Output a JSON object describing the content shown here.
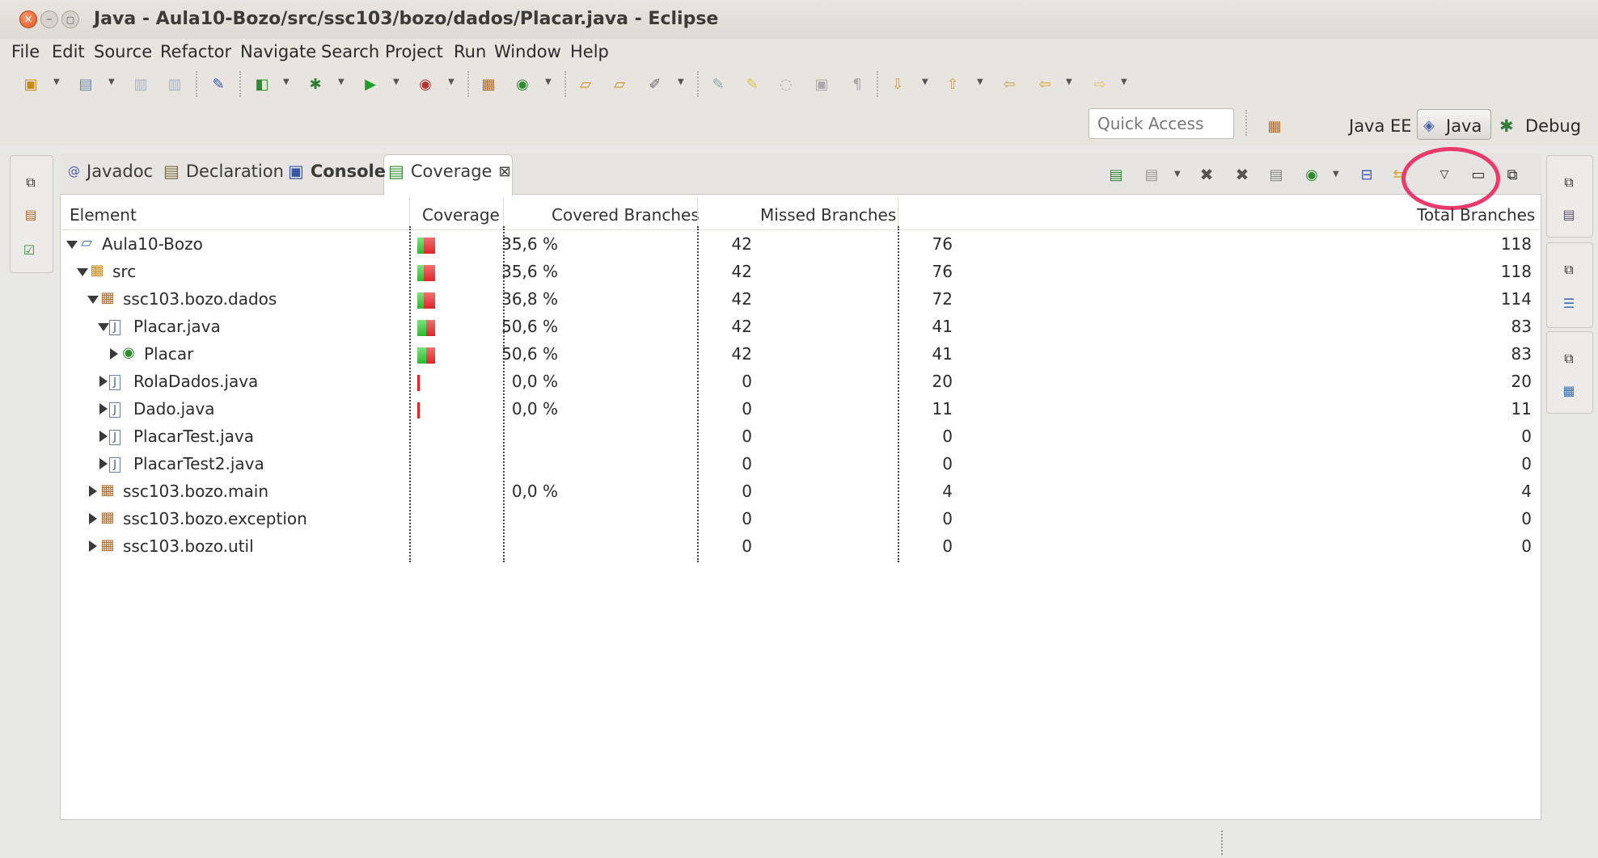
{
  "window": {
    "title": "Java - Aula10-Bozo/src/ssc103/bozo/dados/Placar.java - Eclipse"
  },
  "menu": [
    "File",
    "Edit",
    "Source",
    "Refactor",
    "Navigate",
    "Search",
    "Project",
    "Run",
    "Window",
    "Help"
  ],
  "quick_access": {
    "placeholder": "Quick Access"
  },
  "perspectives": {
    "java_ee": "Java EE",
    "java": "Java",
    "debug": "Debug"
  },
  "tabs": {
    "javadoc": "Javadoc",
    "declaration": "Declaration",
    "console": "Console",
    "coverage": "Coverage"
  },
  "table": {
    "headers": {
      "element": "Element",
      "coverage": "Coverage",
      "covered": "Covered Branches",
      "missed": "Missed Branches",
      "total": "Total Branches"
    },
    "rows": [
      {
        "name": "Aula10-Bozo",
        "coverage": "35,6 %",
        "covered": "42",
        "missed": "76",
        "total": "118"
      },
      {
        "name": "src",
        "coverage": "35,6 %",
        "covered": "42",
        "missed": "76",
        "total": "118"
      },
      {
        "name": "ssc103.bozo.dados",
        "coverage": "36,8 %",
        "covered": "42",
        "missed": "72",
        "total": "114"
      },
      {
        "name": "Placar.java",
        "coverage": "50,6 %",
        "covered": "42",
        "missed": "41",
        "total": "83"
      },
      {
        "name": "Placar",
        "coverage": "50,6 %",
        "covered": "42",
        "missed": "41",
        "total": "83"
      },
      {
        "name": "RolaDados.java",
        "coverage": "0,0 %",
        "covered": "0",
        "missed": "20",
        "total": "20"
      },
      {
        "name": "Dado.java",
        "coverage": "0,0 %",
        "covered": "0",
        "missed": "11",
        "total": "11"
      },
      {
        "name": "PlacarTest.java",
        "coverage": "",
        "covered": "0",
        "missed": "0",
        "total": "0"
      },
      {
        "name": "PlacarTest2.java",
        "coverage": "",
        "covered": "0",
        "missed": "0",
        "total": "0"
      },
      {
        "name": "ssc103.bozo.main",
        "coverage": "0,0 %",
        "covered": "0",
        "missed": "4",
        "total": "4"
      },
      {
        "name": "ssc103.bozo.exception",
        "coverage": "",
        "covered": "0",
        "missed": "0",
        "total": "0"
      },
      {
        "name": "ssc103.bozo.util",
        "coverage": "",
        "covered": "0",
        "missed": "0",
        "total": "0"
      }
    ]
  },
  "colors": {
    "covered": "#2fb82f",
    "missed": "#e0242a",
    "annotation": "#ea3a6b"
  },
  "icons": [
    "close-icon",
    "minimize-icon",
    "maximize-icon",
    "new-icon",
    "save-icon",
    "debug-icon",
    "run-icon",
    "search-icon",
    "view-menu-icon",
    "minimize-view-icon",
    "maximize-view-icon",
    "package-icon",
    "class-icon",
    "java-file-icon",
    "project-icon"
  ]
}
